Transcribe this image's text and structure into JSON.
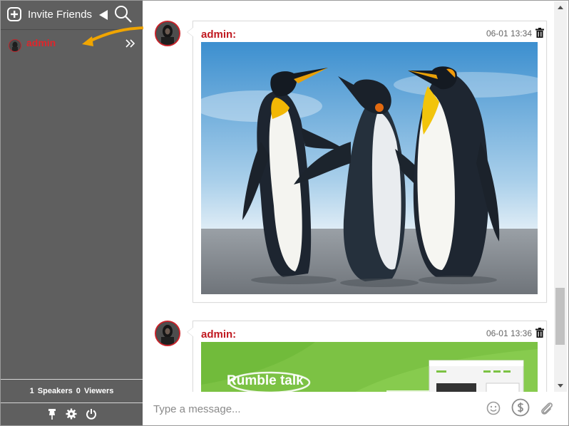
{
  "sidebar": {
    "invite_label": "Invite Friends",
    "users": [
      {
        "name": "admin"
      }
    ],
    "stats": {
      "speakers_count": "1",
      "speakers_label": "Speakers",
      "viewers_count": "0",
      "viewers_label": "Viewers"
    }
  },
  "messages": [
    {
      "author": "admin:",
      "time": "06-01 13:34",
      "attachment": "image"
    },
    {
      "author": "admin:",
      "time": "06-01 13:36",
      "attachment": "image",
      "image_text": "Rumble talk"
    }
  ],
  "composer": {
    "placeholder": "Type a message..."
  },
  "colors": {
    "sidebar_bg": "#5f5f5f",
    "username_red": "#e0252b",
    "author_red": "#c0181f",
    "annotation_arrow": "#f0a500"
  },
  "icons": [
    "plus-circle-icon",
    "collapse-arrow-icon",
    "search-icon",
    "double-chevron-icon",
    "pin-icon",
    "gear-icon",
    "power-icon",
    "trash-icon",
    "emoji-icon",
    "dollar-icon",
    "paperclip-icon"
  ]
}
